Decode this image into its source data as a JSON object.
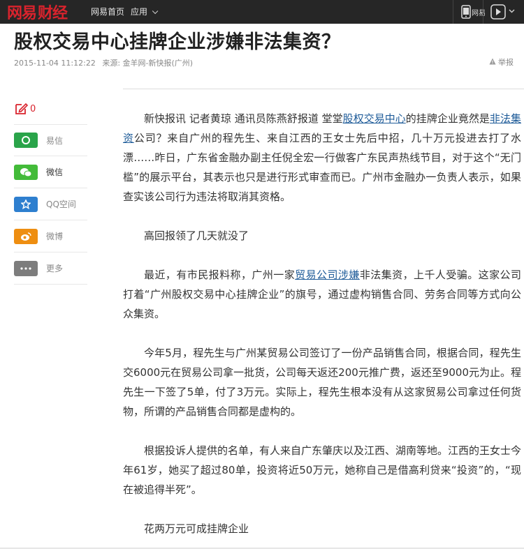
{
  "topbar": {
    "logo_part1": "网易",
    "logo_part2": "财经",
    "nav_home": "网易首页",
    "nav_apps": "应用",
    "phone_label": "网易"
  },
  "article": {
    "title": "股权交易中心挂牌企业涉嫌非法集资？",
    "timestamp": "2015-11-04 11:12:22",
    "source": "来源: 金羊网-新快报(广州)",
    "report_label": "举报",
    "comment_count": "0",
    "p1_a": "新快报讯 记者黄琼 通讯员陈燕舒报道 堂堂",
    "p1_link1": "股权交易中心",
    "p1_b": "的挂牌企业竟然是",
    "p1_link2": "非法集资",
    "p1_c": "公司？来自广州的程先生、来自江西的王女士先后中招，几十万元投进去打了水漂……昨日，广东省金融办副主任倪全宏一行做客广东民声热线节目，对于这个“无门槛”的展示平台，其表示也只是进行形式审查而已。广州市金融办一负责人表示，如果查实该公司行为违法将取消其资格。",
    "subhead1": "高回报领了几天就没了",
    "p2_a": "最近，有市民报料称，广州一家",
    "p2_link": "贸易公司涉嫌",
    "p2_b": "非法集资，上千人受骗。这家公司打着“广州股权交易中心挂牌企业”的旗号，通过虚构销售合同、劳务合同等方式向公众集资。",
    "p3": "今年5月，程先生与广州某贸易公司签订了一份产品销售合同，根据合同，程先生交6000元在贸易公司拿一批货，公司每天返还200元推广费，返还至9000元为止。程先生一下签了5单，付了3万元。实际上，程先生根本没有从这家贸易公司拿过任何货物，所谓的产品销售合同都是虚构的。",
    "p4": "根据投诉人提供的名单，有人来自广东肇庆以及江西、湖南等地。江西的王女士今年61岁，她买了超过80单，投资将近50万元，她称自己是借高利贷来“投资”的，“现在被追得半死”。",
    "subhead2": "花两万元可成挂牌企业"
  },
  "share": {
    "items": [
      {
        "label": "易信",
        "icon": "yixin-icon",
        "color": "#2aa44a"
      },
      {
        "label": "微信",
        "icon": "wechat-icon",
        "color": "#43bb39"
      },
      {
        "label": "QQ空间",
        "icon": "qzone-icon",
        "color": "#2e7fcf"
      },
      {
        "label": "微博",
        "icon": "weibo-icon",
        "color": "#ee8e11"
      },
      {
        "label": "更多",
        "icon": "more-icon",
        "color": "#7d7d7d"
      }
    ]
  },
  "colors": {
    "accent": "#d9232d",
    "link": "#1f5c99",
    "topbar_bg": "#262626"
  }
}
